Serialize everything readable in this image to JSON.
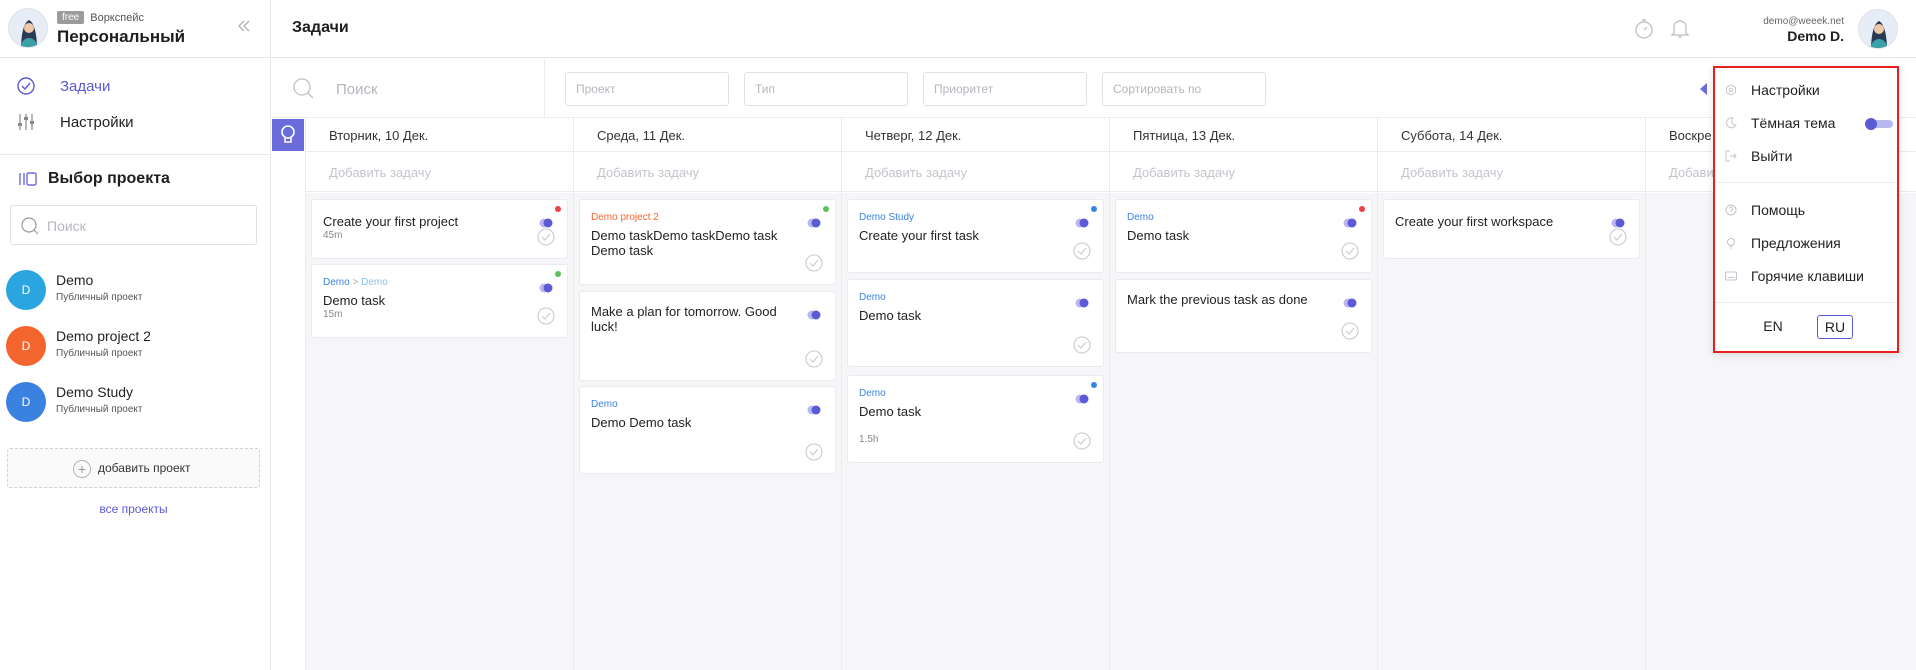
{
  "workspace": {
    "plan_badge": "free",
    "plan_label": "Воркспейс",
    "name": "Персональный",
    "collapse_icon": "double-chevron-left-icon"
  },
  "nav": [
    {
      "label": "Задачи",
      "icon": "check-circle-icon",
      "active": true
    },
    {
      "label": "Настройки",
      "icon": "sliders-icon",
      "active": false
    }
  ],
  "projects_section": {
    "title": "Выбор проекта",
    "search_placeholder": "Поиск",
    "items": [
      {
        "avatar": "D",
        "name": "Demo",
        "sub": "Публичный проект",
        "color": "#2aa5e0"
      },
      {
        "avatar": "D",
        "name": "Demo project 2",
        "sub": "Публичный проект",
        "color": "#f4652d"
      },
      {
        "avatar": "D",
        "name": "Demo Study",
        "sub": "Публичный проект",
        "color": "#3b82e0"
      }
    ],
    "add_label": "добавить проект",
    "all_label": "все проекты"
  },
  "header": {
    "title": "Задачи",
    "user_email": "demo@weeek.net",
    "user_name": "Demo D."
  },
  "filters": {
    "search_placeholder": "Поиск",
    "project": "Проект",
    "type": "Тип",
    "priority": "Приоритет",
    "sort": "Сортировать по"
  },
  "days": [
    {
      "date": "Вторник, 10 Дек.",
      "add": "Добавить задачу"
    },
    {
      "date": "Среда, 11 Дек.",
      "add": "Добавить задачу"
    },
    {
      "date": "Четверг, 12 Дек.",
      "add": "Добавить задачу"
    },
    {
      "date": "Пятница, 13 Дек.",
      "add": "Добавить задачу"
    },
    {
      "date": "Суббота, 14 Дек.",
      "add": "Добавить задачу"
    },
    {
      "date": "Воскре",
      "add": "Добави"
    }
  ],
  "cards": {
    "tue_1": {
      "title": "Create your first project",
      "duration": "45m",
      "dot": "#e8424a"
    },
    "tue_2": {
      "project": "Demo",
      "subproject": "Demo",
      "arrow": ">",
      "title": "Demo task",
      "duration": "15m",
      "dot": "#5cc25c"
    },
    "wed_1": {
      "project": "Demo project 2",
      "title": "Demo taskDemo taskDemo task Demo task",
      "dot": "#5cc25c"
    },
    "wed_2": {
      "title": "Make a plan for tomorrow. Good luck!"
    },
    "wed_3": {
      "project": "Demo",
      "title": "Demo Demo task"
    },
    "thu_1": {
      "project": "Demo Study",
      "title": "Create your first task",
      "dot": "#3b82e0"
    },
    "thu_2": {
      "project": "Demo",
      "title": "Demo task"
    },
    "thu_3": {
      "project": "Demo",
      "title": "Demo task",
      "duration": "1.5h",
      "dot": "#3b82e0"
    },
    "fri_1": {
      "project": "Demo",
      "title": "Demo task",
      "dot": "#e8424a"
    },
    "fri_2": {
      "title": "Mark the previous task as done"
    },
    "sat_1": {
      "title": "Create your first workspace"
    }
  },
  "menu": {
    "settings": "Настройки",
    "dark_theme": "Тёмная тема",
    "dark_theme_on": true,
    "logout": "Выйти",
    "help": "Помощь",
    "suggestions": "Предложения",
    "hotkeys": "Горячие клавиши",
    "lang_en": "EN",
    "lang_ru": "RU",
    "active_lang": "RU"
  },
  "colors": {
    "accent": "#5b5bd6",
    "highlight_border": "#e8201d"
  }
}
